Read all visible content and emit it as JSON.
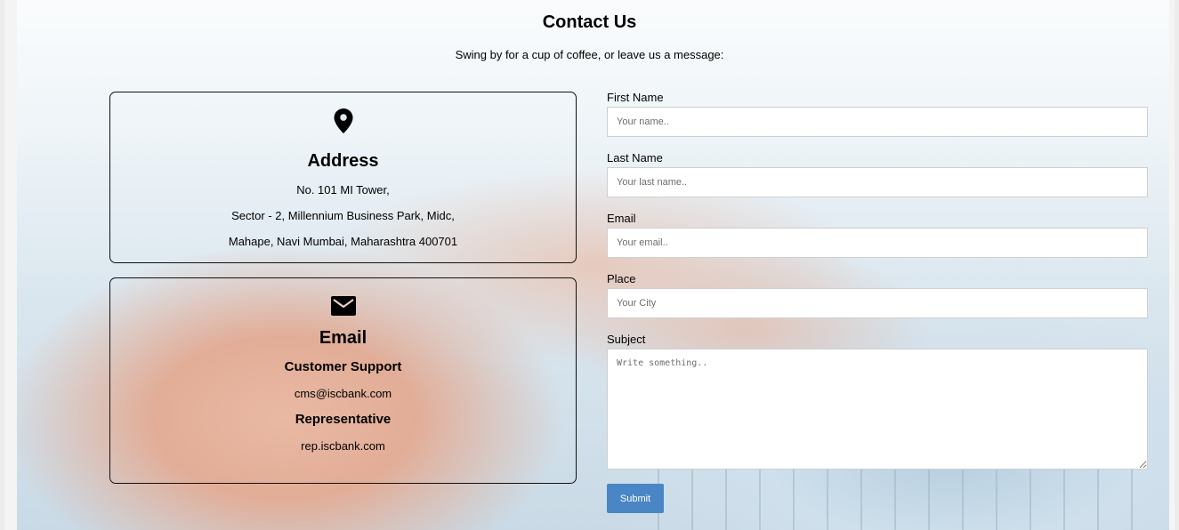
{
  "header": {
    "title": "Contact Us",
    "subtitle": "Swing by for a cup of coffee, or leave us a message:"
  },
  "address_card": {
    "icon": "map-pin-icon",
    "heading": "Address",
    "lines": [
      "No. 101 MI Tower,",
      "Sector - 2, Millennium Business Park, Midc,",
      "Mahape, Navi Mumbai, Maharashtra 400701"
    ]
  },
  "email_card": {
    "icon": "envelope-icon",
    "heading": "Email",
    "support_heading": "Customer Support",
    "support_email": "cms@iscbank.com",
    "rep_heading": "Representative",
    "rep_email": "rep.iscbank.com"
  },
  "form": {
    "first_name": {
      "label": "First Name",
      "placeholder": "Your name.."
    },
    "last_name": {
      "label": "Last Name",
      "placeholder": "Your last name.."
    },
    "email": {
      "label": "Email",
      "placeholder": "Your email.."
    },
    "place": {
      "label": "Place",
      "placeholder": "Your City"
    },
    "subject": {
      "label": "Subject",
      "placeholder": "Write something.."
    },
    "submit_label": "Submit"
  },
  "colors": {
    "accent": "#4a86c5",
    "card_border": "#111111"
  }
}
